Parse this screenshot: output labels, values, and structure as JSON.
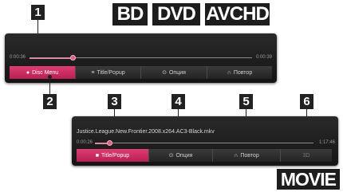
{
  "callouts": [
    "1",
    "2",
    "3",
    "4",
    "5",
    "6"
  ],
  "formats": {
    "bd": "BD",
    "dvd": "DVD",
    "avchd": "AVCHD",
    "movie": "MOVIE"
  },
  "top_panel": {
    "time_start": "0:00:36",
    "time_end": "0:00:39",
    "progress": 0.17,
    "buttons": [
      {
        "label": "Disc Menu",
        "icon": "disc-icon",
        "glyph": "●"
      },
      {
        "label": "Title/Popup",
        "icon": "menu-list-icon",
        "glyph": "≡"
      },
      {
        "label": "Опция",
        "icon": "option-icon",
        "glyph": "⊙"
      },
      {
        "label": "Повтор",
        "icon": "repeat-icon",
        "glyph": "∩"
      }
    ]
  },
  "bottom_panel": {
    "filename": "Justice.League.New.Frontier.2008.x264.AC3-Black.mkv",
    "time_start": "0:00:26",
    "time_end": "1:17:46",
    "progress": 0.06,
    "buttons": [
      {
        "label": "Title/Popup",
        "icon": "menu-list-icon",
        "glyph": "■"
      },
      {
        "label": "Опция",
        "icon": "option-icon",
        "glyph": "⊙"
      },
      {
        "label": "Повтор",
        "icon": "repeat-icon",
        "glyph": "∩"
      },
      {
        "label": "3D",
        "icon": "3d-icon"
      }
    ]
  },
  "colors": {
    "accent": "#d22a62",
    "panel": "#1e1e1e",
    "label_bg": "#222222"
  }
}
